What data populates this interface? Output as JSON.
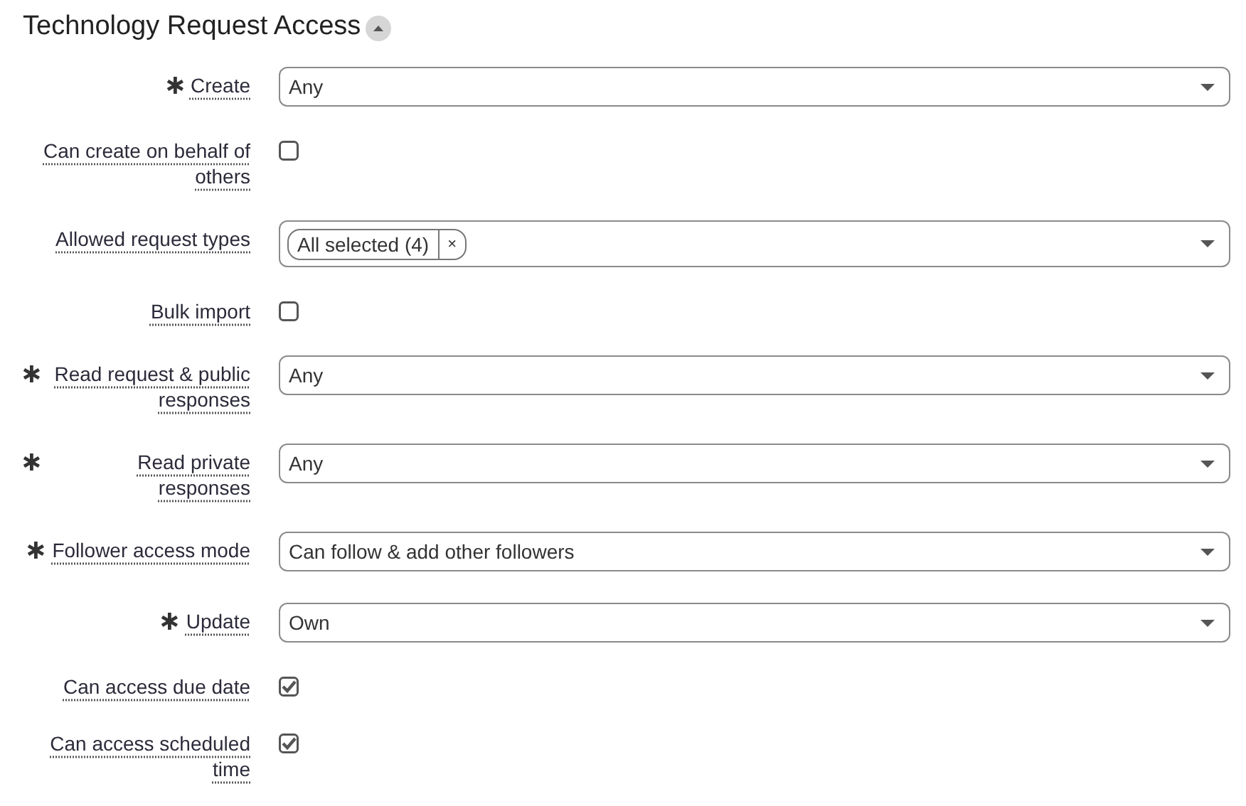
{
  "section": {
    "title": "Technology Request Access",
    "expanded": true
  },
  "fields": [
    {
      "label": "Create",
      "required": true,
      "kind": "select",
      "value": "Any"
    },
    {
      "label": "Can create on behalf of others",
      "required": false,
      "kind": "checkbox",
      "checked": false
    },
    {
      "label": "Allowed request types",
      "required": false,
      "kind": "multiselect",
      "chips": [
        {
          "label": "All selected (4)",
          "remove": "×"
        }
      ]
    },
    {
      "label": "Bulk import",
      "required": false,
      "kind": "checkbox",
      "checked": false
    },
    {
      "label": "Read request & public responses",
      "required": true,
      "kind": "select",
      "value": "Any"
    },
    {
      "label": "Read private responses",
      "required": true,
      "kind": "select",
      "value": "Any"
    },
    {
      "label": "Follower access mode",
      "required": true,
      "kind": "select",
      "value": "Can follow & add other followers"
    },
    {
      "label": "Update",
      "required": true,
      "kind": "select",
      "value": "Own"
    },
    {
      "label": "Can access due date",
      "required": false,
      "kind": "checkbox",
      "checked": true
    },
    {
      "label": "Can access scheduled time",
      "required": false,
      "kind": "checkbox",
      "checked": true
    }
  ]
}
